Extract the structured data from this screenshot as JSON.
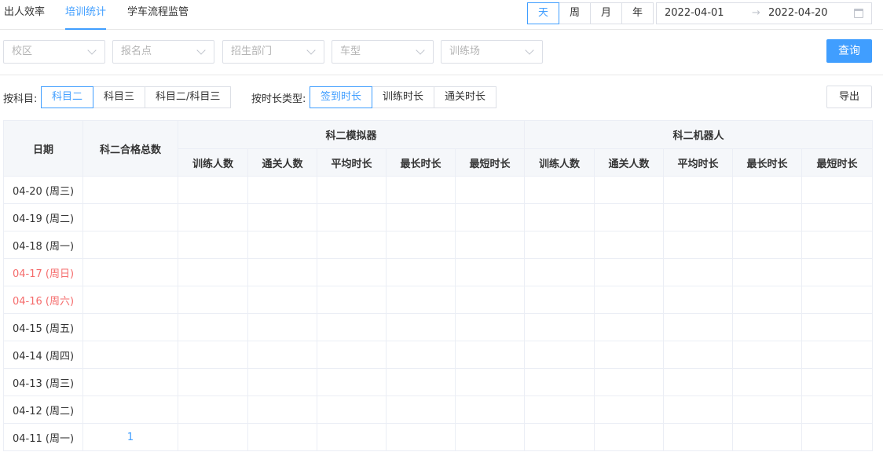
{
  "tabs": [
    {
      "label": "出人效率",
      "active": false
    },
    {
      "label": "培训统计",
      "active": true
    },
    {
      "label": "学车流程监管",
      "active": false
    }
  ],
  "period_buttons": [
    {
      "label": "天",
      "active": true
    },
    {
      "label": "周",
      "active": false
    },
    {
      "label": "月",
      "active": false
    },
    {
      "label": "年",
      "active": false
    }
  ],
  "date_range": {
    "start": "2022-04-01",
    "separator": "→",
    "end": "2022-04-20",
    "icon": "calendar-icon"
  },
  "filters": [
    {
      "placeholder": "校区"
    },
    {
      "placeholder": "报名点"
    },
    {
      "placeholder": "招生部门"
    },
    {
      "placeholder": "车型"
    },
    {
      "placeholder": "训练场"
    }
  ],
  "query_label": "查询",
  "subject_label": "按科目:",
  "subject_options": [
    {
      "label": "科目二",
      "active": true
    },
    {
      "label": "科目三",
      "active": false
    },
    {
      "label": "科目二/科目三",
      "active": false
    }
  ],
  "duration_label": "按时长类型:",
  "duration_options": [
    {
      "label": "签到时长",
      "active": true
    },
    {
      "label": "训练时长",
      "active": false
    },
    {
      "label": "通关时长",
      "active": false
    }
  ],
  "export_label": "导出",
  "colors": {
    "accent": "#409eff",
    "weekend": "#f56c6c",
    "header_bg": "#f5f7fa",
    "border": "#ebeef5"
  },
  "table": {
    "col_date": "日期",
    "col_total": "科二合格总数",
    "group_simulator": "科二模拟器",
    "group_robot": "科二机器人",
    "sub_cols": [
      "训练人数",
      "通关人数",
      "平均时长",
      "最长时长",
      "最短时长"
    ],
    "rows": [
      {
        "date": "04-20 (周三)",
        "total": "",
        "weekend": false
      },
      {
        "date": "04-19 (周二)",
        "total": "",
        "weekend": false
      },
      {
        "date": "04-18 (周一)",
        "total": "",
        "weekend": false
      },
      {
        "date": "04-17 (周日)",
        "total": "",
        "weekend": true
      },
      {
        "date": "04-16 (周六)",
        "total": "",
        "weekend": true
      },
      {
        "date": "04-15 (周五)",
        "total": "",
        "weekend": false
      },
      {
        "date": "04-14 (周四)",
        "total": "",
        "weekend": false
      },
      {
        "date": "04-13 (周三)",
        "total": "",
        "weekend": false
      },
      {
        "date": "04-12 (周二)",
        "total": "",
        "weekend": false
      },
      {
        "date": "04-11 (周一)",
        "total": "1",
        "weekend": false
      }
    ]
  }
}
